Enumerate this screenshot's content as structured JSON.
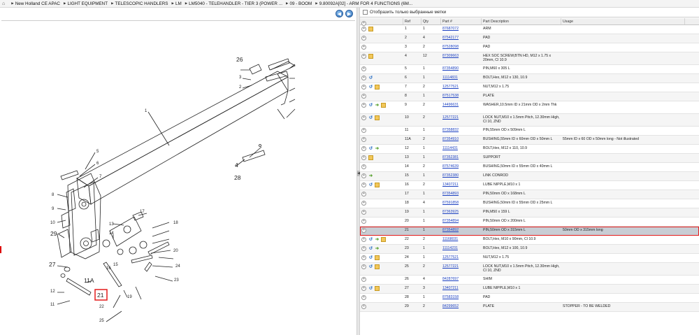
{
  "breadcrumb": {
    "items": [
      "New Holland CE APAC",
      "LIGHT EQUIPMENT",
      "TELESCOPIC HANDLERS",
      "LM",
      "LM5040 - TELEHANDLER - TIER 3 (POWER ...",
      "09 - BOOM",
      "9.80092A[02] - ARM FOR 4 FUNCTIONS (6M..."
    ]
  },
  "nav": {
    "back": "◀",
    "forward": "▶"
  },
  "filter": {
    "label": "Отобразить только выбранные метки",
    "checked": false
  },
  "table": {
    "columns": {
      "ref": "Ref",
      "qty": "Qty",
      "part": "Part #",
      "desc": "Part Description",
      "usage": "Usage"
    },
    "rows": [
      {
        "icons": [
          "box"
        ],
        "ref": "1",
        "qty": "1",
        "part": "87687072",
        "desc": "ARM",
        "usage": ""
      },
      {
        "icons": [],
        "ref": "2",
        "qty": "4",
        "part": "87542177",
        "desc": "PAD",
        "usage": ""
      },
      {
        "icons": [],
        "ref": "3",
        "qty": "2",
        "part": "87528098",
        "desc": "PAD",
        "usage": ""
      },
      {
        "icons": [
          "box"
        ],
        "ref": "4",
        "qty": "12",
        "part": "87309663",
        "desc": "HEX SOC SCREW,BTN HD, M12 x 1.75 x 20mm, Cl 10.9",
        "usage": ""
      },
      {
        "icons": [],
        "ref": "5",
        "qty": "1",
        "part": "87354890",
        "desc": "PIN,M60 x 305 L",
        "usage": ""
      },
      {
        "icons": [
          "rev"
        ],
        "ref": "6",
        "qty": "1",
        "part": "11114831",
        "desc": "BOLT,Hex, M12 x 130, 10.9",
        "usage": ""
      },
      {
        "icons": [
          "rev",
          "box"
        ],
        "ref": "7",
        "qty": "2",
        "part": "12577521",
        "desc": "NUT,M12 x 1.75",
        "usage": ""
      },
      {
        "icons": [],
        "ref": "8",
        "qty": "1",
        "part": "87517538",
        "desc": "PLATE",
        "usage": ""
      },
      {
        "icons": [
          "rev",
          "arr",
          "box"
        ],
        "ref": "9",
        "qty": "2",
        "part": "14496631",
        "desc": "WASHER,10.5mm ID x 21mm OD x 2mm Thk",
        "usage": ""
      },
      {
        "icons": [
          "rev",
          "box"
        ],
        "ref": "10",
        "qty": "2",
        "part": "12577221",
        "desc": "LOCK NUT,M10 x 1.5mm Pitch, 12.30mm High, Cl 10, ZND",
        "usage": ""
      },
      {
        "icons": [],
        "ref": "11",
        "qty": "1",
        "part": "87358832",
        "desc": "PIN,55mm OD x 509mm L",
        "usage": ""
      },
      {
        "icons": [],
        "ref": "11A",
        "qty": "2",
        "part": "87354910",
        "desc": "BUSHING,55mm ID x 60mm OD x 50mm L",
        "usage": "55mm ID x 60 OD x 50mm long - Not illustrated"
      },
      {
        "icons": [
          "rev",
          "arr"
        ],
        "ref": "12",
        "qty": "1",
        "part": "11114431",
        "desc": "BOLT,Hex, M12 x 110, 10.9",
        "usage": ""
      },
      {
        "icons": [
          "box"
        ],
        "ref": "13",
        "qty": "1",
        "part": "87352381",
        "desc": "SUPPORT",
        "usage": ""
      },
      {
        "icons": [],
        "ref": "14",
        "qty": "2",
        "part": "87574639",
        "desc": "BUSHING,50mm ID x 55mm OD x 40mm L",
        "usage": ""
      },
      {
        "icons": [
          "arr"
        ],
        "ref": "15",
        "qty": "1",
        "part": "87352380",
        "desc": "LINK CONROD",
        "usage": ""
      },
      {
        "icons": [
          "rev",
          "box"
        ],
        "ref": "16",
        "qty": "2",
        "part": "13407211",
        "desc": "LUBE NIPPLE,M10 x 1",
        "usage": ""
      },
      {
        "icons": [],
        "ref": "17",
        "qty": "1",
        "part": "87354893",
        "desc": "PIN,50mm OD x 168mm L",
        "usage": ""
      },
      {
        "icons": [],
        "ref": "18",
        "qty": "4",
        "part": "87591858",
        "desc": "BUSHING,50mm ID x 55mm OD x 25mm L",
        "usage": ""
      },
      {
        "icons": [],
        "ref": "19",
        "qty": "1",
        "part": "87363925",
        "desc": "PIN,M50 x 159 L",
        "usage": ""
      },
      {
        "icons": [],
        "ref": "20",
        "qty": "1",
        "part": "87354894",
        "desc": "PIN,50mm OD x 200mm L",
        "usage": ""
      },
      {
        "icons": [],
        "ref": "21",
        "qty": "1",
        "part": "87354892",
        "desc": "PIN,50mm OD x 315mm L",
        "usage": "50mm OD x 315mm long",
        "selected": true
      },
      {
        "icons": [
          "rev",
          "arr",
          "box"
        ],
        "ref": "22",
        "qty": "2",
        "part": "11168031",
        "desc": "BOLT,Hex, M10 x 90mm, Cl 10.9",
        "usage": ""
      },
      {
        "icons": [
          "rev",
          "arr"
        ],
        "ref": "23",
        "qty": "1",
        "part": "11114231",
        "desc": "BOLT,Hex, M12 x 100, 10.9",
        "usage": ""
      },
      {
        "icons": [
          "rev",
          "box"
        ],
        "ref": "24",
        "qty": "1",
        "part": "12577521",
        "desc": "NUT,M12 x 1.75",
        "usage": ""
      },
      {
        "icons": [
          "rev",
          "box"
        ],
        "ref": "25",
        "qty": "2",
        "part": "12577221",
        "desc": "LOCK NUT,M10 x 1.5mm Pitch, 12.30mm High, Cl 10, ZND",
        "usage": ""
      },
      {
        "icons": [],
        "ref": "26",
        "qty": "4",
        "part": "84287697",
        "desc": "SHIM",
        "usage": ""
      },
      {
        "icons": [
          "rev",
          "box"
        ],
        "ref": "27",
        "qty": "3",
        "part": "13407211",
        "desc": "LUBE NIPPLE,M10 x 1",
        "usage": ""
      },
      {
        "icons": [],
        "ref": "28",
        "qty": "1",
        "part": "87583158",
        "desc": "PAD",
        "usage": ""
      },
      {
        "icons": [],
        "ref": "29",
        "qty": "2",
        "part": "84299652",
        "desc": "PLATE",
        "usage": "STOPPER - TO BE WELDED"
      }
    ]
  },
  "diagram": {
    "callouts": {
      "c26": "26",
      "c4a": "4",
      "c28": "28",
      "c29": "29",
      "c27": "27",
      "c11A": "11A",
      "c21": "21",
      "c1": "1",
      "c5": "5",
      "c6": "6",
      "c7": "7",
      "c8": "8",
      "c9": "9",
      "c10": "10",
      "c11": "11",
      "c12": "12",
      "c13": "13",
      "c14": "14",
      "c15": "15",
      "c16": "16",
      "c17": "17",
      "c18": "18",
      "c19": "19",
      "c20": "20",
      "c22": "22",
      "c23": "23",
      "c24": "24",
      "c25": "25",
      "c2": "2",
      "c3": "3"
    },
    "selected_ref": "21"
  }
}
